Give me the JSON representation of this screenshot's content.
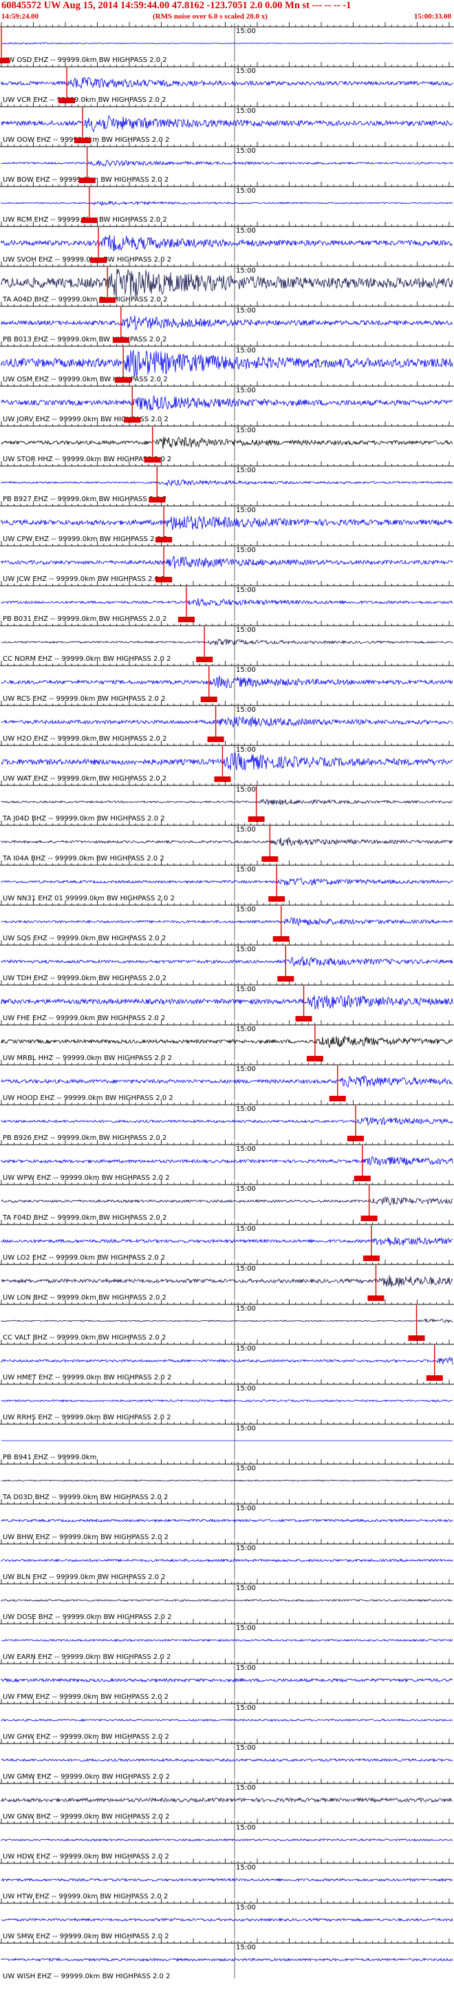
{
  "header": {
    "title": "60845572 UW Aug 15, 2014 14:59:44.00   47.8162 -123.7051  2.0 0.00 Mn st --- -- --   -1",
    "start_time": "14:59:24.00",
    "noise_note": "(RMS noise over 6.0 s scaled 20.0 x)",
    "end_time": "15:00:33.00"
  },
  "tick_label": "15:00",
  "colors": {
    "trace_blue": "#0000ee",
    "trace_dark": "#12124a",
    "trace_black": "#000000",
    "pick_red": "#e00000",
    "axis": "#000000"
  },
  "traces": [
    {
      "label": "UW OSD EHZ -- 99999.0km BW  HIGHPASS  2.0  2",
      "color": "blue",
      "amp": 1,
      "pick": 0.0
    },
    {
      "label": "UW VCR EHZ -- 99999.0km BW  HIGHPASS  2.0  2",
      "color": "blue",
      "amp": 6,
      "pick": 0.145
    },
    {
      "label": "UW OOW EHZ -- 99999.0km BW  HIGHPASS  2.0  2",
      "color": "blue",
      "amp": 8,
      "pick": 0.18
    },
    {
      "label": "UW BOW EHZ -- 99999.0km BW  HIGHPASS  2.0  2",
      "color": "blue",
      "amp": 3,
      "pick": 0.19
    },
    {
      "label": "UW RCM EHZ -- 99999.0km BW  HIGHPASS  2.0  2",
      "color": "blue",
      "amp": 2,
      "pick": 0.195
    },
    {
      "label": "UW SVOH EHZ -- 99999.0km BW  HIGHPASS  2.0  2",
      "color": "blue",
      "amp": 8,
      "pick": 0.215
    },
    {
      "label": "TA A04D BHZ -- 99999.0km BW  HIGHPASS  2.0  2",
      "color": "dark",
      "amp": 16,
      "pick": 0.235
    },
    {
      "label": "PB B013 EHZ -- 99999.0km BW  HIGHPASS  2.0  2",
      "color": "blue",
      "amp": 7,
      "pick": 0.265
    },
    {
      "label": "UW OSM EHZ -- 99999.0km BW  HIGHPASS  2.0  2",
      "color": "blue",
      "amp": 14,
      "pick": 0.27
    },
    {
      "label": "UW JORV EHZ -- 99999.0km BW  HIGHPASS  2.0  2",
      "color": "blue",
      "amp": 8,
      "pick": 0.29
    },
    {
      "label": "UW STOR HHZ -- 99999.0km BW  HIGHPASS  2.0  2",
      "color": "black",
      "amp": 6,
      "pick": 0.335
    },
    {
      "label": "PB B927 EHZ -- 99999.0km BW  HIGHPASS  2.0  2",
      "color": "blue",
      "amp": 3,
      "pick": 0.345
    },
    {
      "label": "UW CPW EHZ -- 99999.0km BW  HIGHPASS  2.0  2",
      "color": "blue",
      "amp": 8,
      "pick": 0.36
    },
    {
      "label": "UW JCW EHZ -- 99999.0km BW  HIGHPASS  2.0  2",
      "color": "blue",
      "amp": 6,
      "pick": 0.36
    },
    {
      "label": "PB B031 EHZ -- 99999.0km BW  HIGHPASS  2.0  2",
      "color": "blue",
      "amp": 4,
      "pick": 0.41
    },
    {
      "label": "CC NORM EHZ -- 99999.0km BW  HIGHPASS  2.0  2",
      "color": "dark",
      "amp": 3,
      "pick": 0.45
    },
    {
      "label": "UW RCS EHZ -- 99999.0km BW  HIGHPASS  2.0  2",
      "color": "blue",
      "amp": 6,
      "pick": 0.46
    },
    {
      "label": "UW H2O EHZ -- 99999.0km BW  HIGHPASS  2.0  2",
      "color": "blue",
      "amp": 6,
      "pick": 0.475
    },
    {
      "label": "UW WAT EHZ -- 99999.0km BW  HIGHPASS  2.0  2",
      "color": "blue",
      "amp": 9,
      "pick": 0.49
    },
    {
      "label": "TA J04D BHZ -- 99999.0km BW  HIGHPASS  2.0  2",
      "color": "dark",
      "amp": 3,
      "pick": 0.565
    },
    {
      "label": "TA I04A BHZ -- 99999.0km BW  HIGHPASS  2.0  2",
      "color": "dark",
      "amp": 4,
      "pick": 0.595
    },
    {
      "label": "UW NN31 EHZ 01 99999.0km BW  HIGHPASS  2.0  2",
      "color": "blue",
      "amp": 4,
      "pick": 0.61
    },
    {
      "label": "UW SQS EHZ -- 99999.0km BW  HIGHPASS  2.0  2",
      "color": "blue",
      "amp": 4,
      "pick": 0.62
    },
    {
      "label": "UW TDH EHZ -- 99999.0km BW  HIGHPASS  2.0  2",
      "color": "blue",
      "amp": 5,
      "pick": 0.63
    },
    {
      "label": "UW FHE EHZ -- 99999.0km BW  HIGHPASS  2.0  2",
      "color": "blue",
      "amp": 8,
      "pick": 0.67
    },
    {
      "label": "UW MRBL HHZ -- 99999.0km BW  HIGHPASS  2.0  2",
      "color": "black",
      "amp": 6,
      "pick": 0.695
    },
    {
      "label": "UW HOOD EHZ -- 99999.0km BW  HIGHPASS  2.0  2",
      "color": "blue",
      "amp": 6,
      "pick": 0.745
    },
    {
      "label": "PB B926 EHZ -- 99999.0km BW  HIGHPASS  2.0  2",
      "color": "blue",
      "amp": 4,
      "pick": 0.785
    },
    {
      "label": "UW WPW EHZ -- 99999.0km BW  HIGHPASS  2.0  2",
      "color": "blue",
      "amp": 5,
      "pick": 0.8
    },
    {
      "label": "TA F04D BHZ -- 99999.0km BW  HIGHPASS  2.0  2",
      "color": "dark",
      "amp": 4,
      "pick": 0.815
    },
    {
      "label": "UW LO2 EHZ -- 99999.0km BW  HIGHPASS  2.0  2",
      "color": "blue",
      "amp": 5,
      "pick": 0.82
    },
    {
      "label": "UW LON BHZ -- 99999.0km BW  HIGHPASS  2.0  2",
      "color": "dark",
      "amp": 6,
      "pick": 0.83
    },
    {
      "label": "CC VALT BHZ -- 99999.0km BW  HIGHPASS  2.0  2",
      "color": "dark",
      "amp": 2,
      "pick": 0.92
    },
    {
      "label": "UW HMET EHZ -- 99999.0km BW  HIGHPASS  2.0  2",
      "color": "blue",
      "amp": 4,
      "pick": 0.96
    },
    {
      "label": "UW RRHS EHZ -- 99999.0km BW  HIGHPASS  2.0  2",
      "color": "blue",
      "amp": 3,
      "pick": null
    },
    {
      "label": "PB B941 EHZ -- 99999.0km",
      "color": "blue",
      "amp": 0,
      "pick": null
    },
    {
      "label": "TA D03D BHZ -- 99999.0km BW  HIGHPASS  2.0  2",
      "color": "dark",
      "amp": 2,
      "pick": null
    },
    {
      "label": "UW BHW EHZ -- 99999.0km BW  HIGHPASS  2.0  2",
      "color": "blue",
      "amp": 4,
      "pick": null
    },
    {
      "label": "UW BLN EHZ -- 99999.0km BW  HIGHPASS  2.0  2",
      "color": "blue",
      "amp": 4,
      "pick": null
    },
    {
      "label": "UW DOSE BHZ -- 99999.0km BW  HIGHPASS  2.0  2",
      "color": "dark",
      "amp": 3,
      "pick": null
    },
    {
      "label": "UW EARN EHZ -- 99999.0km BW  HIGHPASS  2.0  2",
      "color": "blue",
      "amp": 3,
      "pick": null
    },
    {
      "label": "UW FMW EHZ -- 99999.0km BW  HIGHPASS  2.0  2",
      "color": "blue",
      "amp": 5,
      "pick": null
    },
    {
      "label": "UW GHW EHZ -- 99999.0km BW  HIGHPASS  2.0  2",
      "color": "blue",
      "amp": 3,
      "pick": null
    },
    {
      "label": "UW GMW EHZ -- 99999.0km BW  HIGHPASS  2.0  2",
      "color": "blue",
      "amp": 4,
      "pick": null
    },
    {
      "label": "UW GNW BHZ -- 99999.0km BW  HIGHPASS  2.0  2",
      "color": "dark",
      "amp": 6,
      "pick": null
    },
    {
      "label": "UW HDW EHZ -- 99999.0km BW  HIGHPASS  2.0  2",
      "color": "blue",
      "amp": 3,
      "pick": null
    },
    {
      "label": "UW HTW EHZ -- 99999.0km BW  HIGHPASS  2.0  2",
      "color": "blue",
      "amp": 4,
      "pick": null
    },
    {
      "label": "UW SMW EHZ -- 99999.0km BW  HIGHPASS  2.0  2",
      "color": "blue",
      "amp": 4,
      "pick": null
    },
    {
      "label": "UW WISH EHZ -- 99999.0km BW  HIGHPASS  2.0  2",
      "color": "blue",
      "amp": 4,
      "pick": null
    }
  ]
}
